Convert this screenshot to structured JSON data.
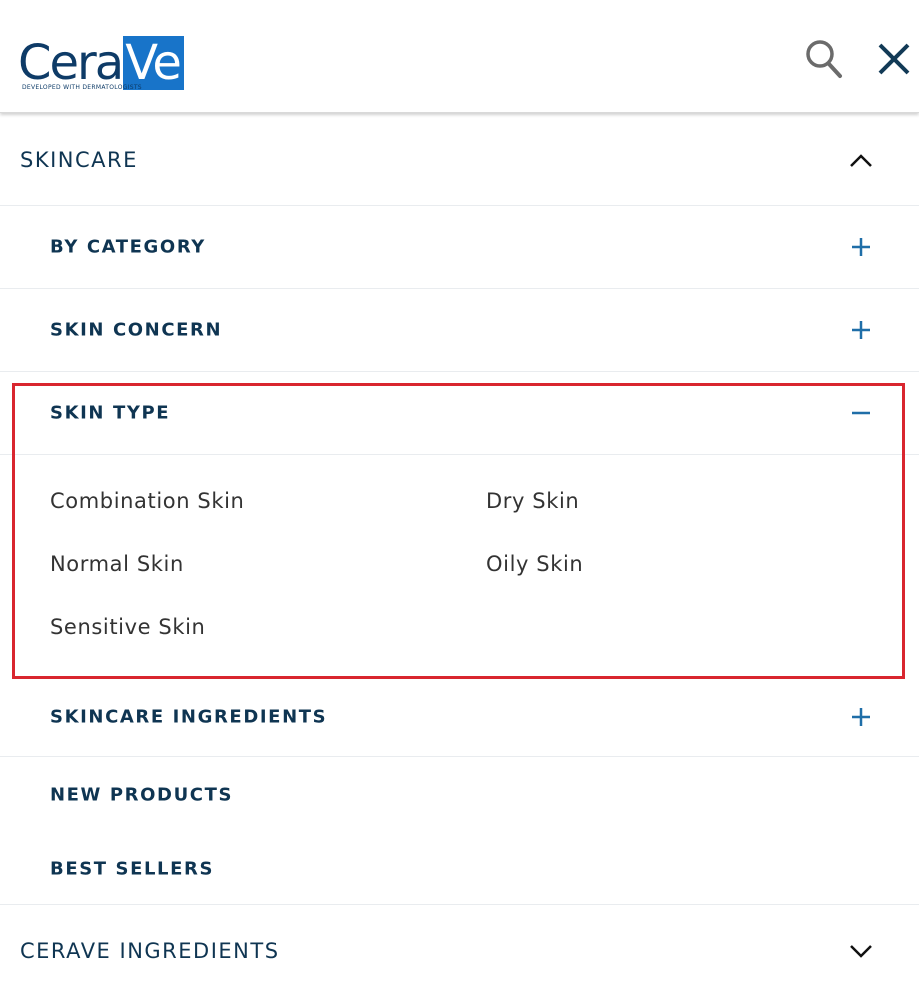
{
  "header": {
    "logo": {
      "brand_part1": "Cera",
      "brand_part2": "Ve",
      "tagline": "DEVELOPED WITH DERMATOLOGISTS"
    },
    "search_icon": "search-icon",
    "close_icon": "close-icon"
  },
  "menu": {
    "skincare": {
      "label": "SKINCARE",
      "state_icon": "chevron-up-icon",
      "children": {
        "by_category": {
          "label": "BY CATEGORY",
          "state_icon": "plus-icon"
        },
        "skin_concern": {
          "label": "SKIN CONCERN",
          "state_icon": "plus-icon"
        },
        "skin_type": {
          "label": "SKIN TYPE",
          "state_icon": "minus-icon",
          "links": [
            "Combination Skin",
            "Dry Skin",
            "Normal Skin",
            "Oily Skin",
            "Sensitive Skin"
          ]
        },
        "skincare_ingredients": {
          "label": "SKINCARE INGREDIENTS",
          "state_icon": "plus-icon"
        },
        "new_products": {
          "label": "NEW PRODUCTS"
        },
        "best_sellers": {
          "label": "BEST SELLERS"
        }
      }
    },
    "cerave_ingredients": {
      "label": "CERAVE INGREDIENTS",
      "state_icon": "chevron-down-icon"
    }
  },
  "colors": {
    "brand_navy": "#0e3b67",
    "brand_blue": "#1874c9",
    "text_navy": "#0f3552",
    "accent_blue": "#1f6ea8",
    "highlight_red": "#d9262f"
  }
}
